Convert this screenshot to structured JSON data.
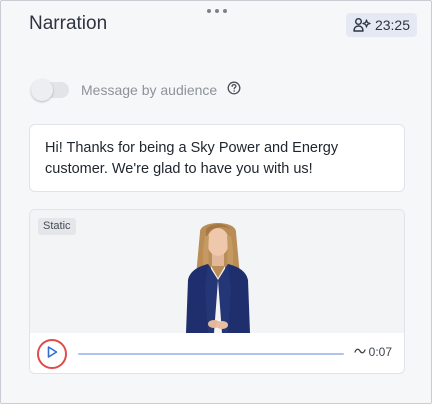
{
  "panel": {
    "title": "Narration",
    "duration": "23:25",
    "duration_icon": "user-sparkle-icon",
    "drag_icon": "drag-handle-icon"
  },
  "audience": {
    "label": "Message by audience",
    "enabled": false,
    "help_icon": "question-circle-icon"
  },
  "message": {
    "text": "Hi! Thanks for being a Sky Power and Energy customer. We're glad to have you with us!"
  },
  "video": {
    "badge": "Static",
    "time": "0:07",
    "time_prefix_icon": "tilde-approx-icon",
    "progress": 0,
    "play_icon": "play-icon",
    "highlight_color": "#e04c4c",
    "accent_color": "#2f6fd6"
  }
}
